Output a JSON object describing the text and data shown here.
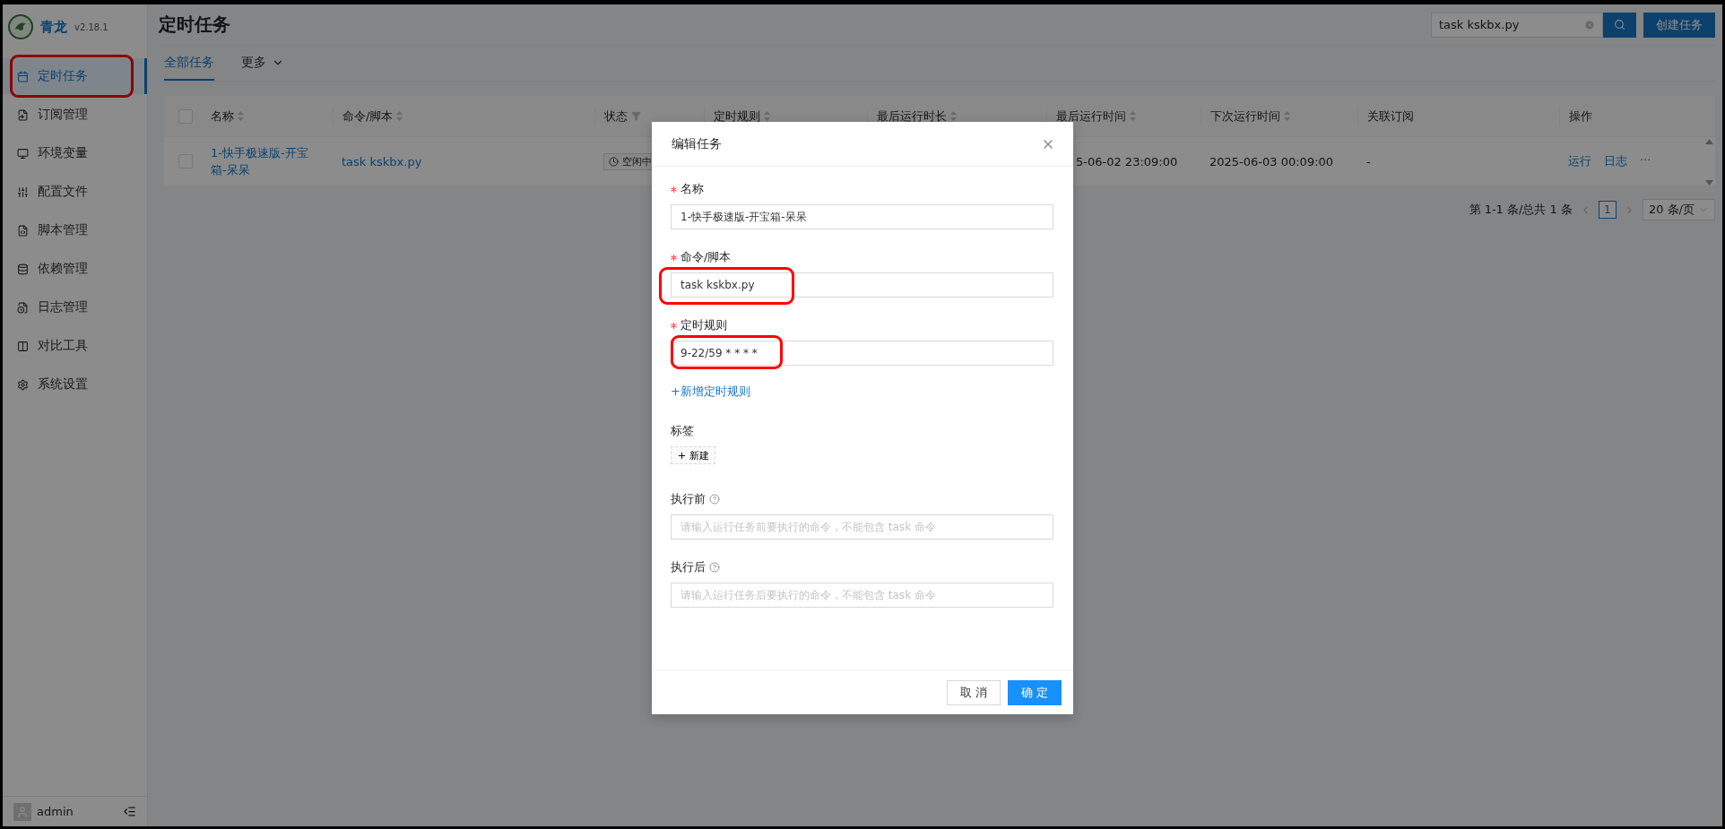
{
  "sidebar": {
    "brand": "青龙",
    "version": "v2.18.1",
    "items": [
      {
        "label": "定时任务",
        "selected": true,
        "annotated": true
      },
      {
        "label": "订阅管理",
        "selected": false,
        "annotated": false
      },
      {
        "label": "环境变量",
        "selected": false,
        "annotated": false
      },
      {
        "label": "配置文件",
        "selected": false,
        "annotated": false
      },
      {
        "label": "脚本管理",
        "selected": false,
        "annotated": false
      },
      {
        "label": "依赖管理",
        "selected": false,
        "annotated": false
      },
      {
        "label": "日志管理",
        "selected": false,
        "annotated": false
      },
      {
        "label": "对比工具",
        "selected": false,
        "annotated": false
      },
      {
        "label": "系统设置",
        "selected": false,
        "annotated": false
      }
    ],
    "user": "admin"
  },
  "header": {
    "title": "定时任务",
    "search": {
      "value": "task kskbx.py"
    },
    "create_button": "创建任务"
  },
  "tabs": [
    {
      "label": "全部任务",
      "selected": true,
      "dropdown": false
    },
    {
      "label": "更多",
      "selected": false,
      "dropdown": true
    }
  ],
  "table": {
    "header_checked": false,
    "columns": [
      {
        "label": "名称",
        "sortable": true
      },
      {
        "label": "命令/脚本",
        "sortable": true
      },
      {
        "label": "状态",
        "filterable": true
      },
      {
        "label": "定时规则",
        "sortable": true
      },
      {
        "label": "最后运行时长",
        "sortable": true
      },
      {
        "label": "最后运行时间",
        "sortable": true
      },
      {
        "label": "下次运行时间",
        "sortable": true
      },
      {
        "label": "关联订阅"
      },
      {
        "label": "操作"
      }
    ],
    "rows": [
      {
        "checked": false,
        "name": "1-快手极速版-开宝箱-呆呆",
        "command": "task kskbx.py",
        "status": "空闲中",
        "last_run": "5-06-02 23:09:00",
        "next_run": "2025-06-03 00:09:00",
        "subscription": "-",
        "actions": [
          "运行",
          "日志",
          "···"
        ]
      }
    ]
  },
  "pagination": {
    "summary": "第 1-1 条/总共 1 条",
    "pages": [
      {
        "label": "1",
        "selected": true
      }
    ],
    "page_size": "20 条/页"
  },
  "modal": {
    "title": "编辑任务",
    "fields": [
      {
        "kind": "input",
        "label": "名称",
        "required": true,
        "value": "1-快手极速版-开宝箱-呆呆",
        "annotated": false
      },
      {
        "kind": "input",
        "label": "命令/脚本",
        "required": true,
        "value": "task kskbx.py",
        "annotated": true
      },
      {
        "kind": "input",
        "label": "定时规则",
        "required": true,
        "value": "9-22/59 * * * *",
        "annotated": true
      },
      {
        "kind": "link",
        "label": "+新增定时规则"
      },
      {
        "kind": "tags",
        "label": "标签",
        "add_button": "新建"
      },
      {
        "kind": "input",
        "label": "执行前",
        "help": true,
        "placeholder": "请输入运行任务前要执行的命令，不能包含 task 命令"
      },
      {
        "kind": "input",
        "label": "执行后",
        "help": true,
        "placeholder": "请输入运行任务后要执行的命令，不能包含 task 命令"
      }
    ],
    "buttons": [
      {
        "label": "取 消",
        "kind": "default"
      },
      {
        "label": "确 定",
        "kind": "primary"
      }
    ]
  }
}
